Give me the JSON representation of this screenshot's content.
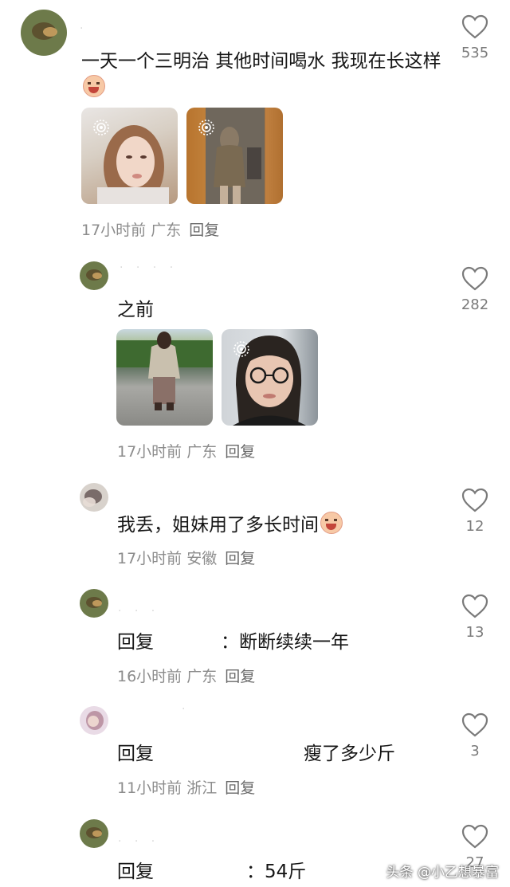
{
  "comments": [
    {
      "text": "一天一个三明治 其他时间喝水 我现在长这样",
      "emoji": "crying-face-emoji",
      "time": "17小时前",
      "location": "广东",
      "reply_label": "回复",
      "likes": "535"
    },
    {
      "text": "之前",
      "time": "17小时前",
      "location": "广东",
      "reply_label": "回复",
      "likes": "282"
    },
    {
      "text": "我丢，姐妹用了多长时间",
      "emoji": "crying-face-emoji",
      "time": "17小时前",
      "location": "安徽",
      "reply_label": "回复",
      "likes": "12"
    },
    {
      "prefix": "回复",
      "text": "：断断续续一年",
      "time": "16小时前",
      "location": "广东",
      "reply_label": "回复",
      "likes": "13"
    },
    {
      "prefix": "回复",
      "text": "瘦了多少斤",
      "time": "11小时前",
      "location": "浙江",
      "reply_label": "回复",
      "likes": "3"
    },
    {
      "prefix": "回复",
      "text": "：54斤",
      "likes": "27"
    }
  ],
  "watermark": "头条 @小乙想暴富",
  "colors": {
    "text": "#161616",
    "meta": "#8c8c8c",
    "like_icon": "#7a7a7a"
  }
}
